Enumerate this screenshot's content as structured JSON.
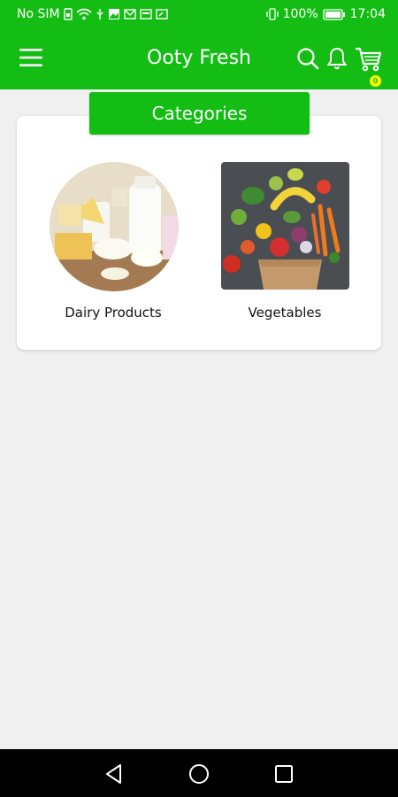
{
  "status_bar": {
    "carrier": "No SIM",
    "battery": "100%",
    "time": "17:04"
  },
  "app_bar": {
    "title": "Ooty Fresh",
    "cart_count": "0"
  },
  "categories": {
    "header": "Categories",
    "items": [
      {
        "label": "Dairy Products"
      },
      {
        "label": "Vegetables"
      }
    ]
  },
  "colors": {
    "primary": "#14bd14",
    "badge": "#ffff00",
    "background": "#f0f0f0"
  }
}
